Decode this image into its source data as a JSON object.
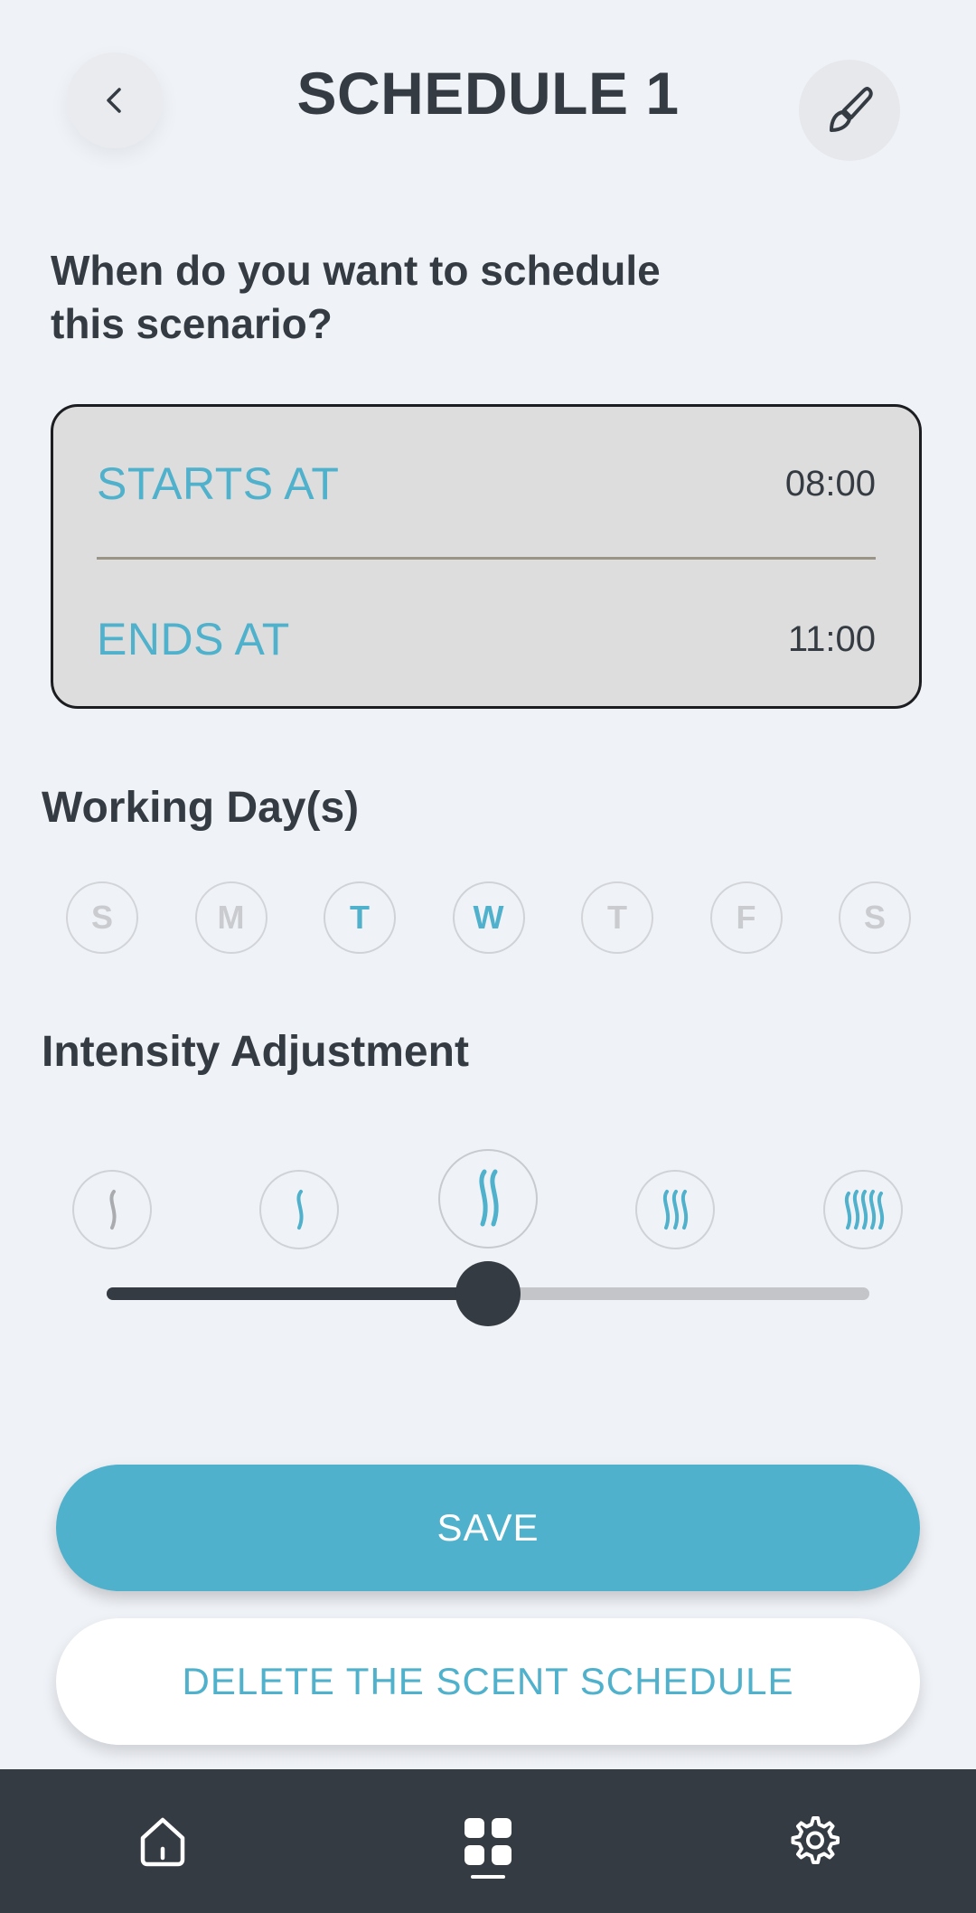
{
  "header": {
    "title": "SCHEDULE 1",
    "back_icon": "chevron-left-icon",
    "edit_icon": "paint-brush-icon"
  },
  "question": "When do you want to schedule this scenario?",
  "time": {
    "starts_label": "STARTS AT",
    "starts_value": "08:00",
    "ends_label": "ENDS AT",
    "ends_value": "11:00"
  },
  "working_days": {
    "heading": "Working Day(s)",
    "days": [
      {
        "label": "S",
        "active": false
      },
      {
        "label": "M",
        "active": false
      },
      {
        "label": "T",
        "active": true
      },
      {
        "label": "W",
        "active": true
      },
      {
        "label": "T",
        "active": false
      },
      {
        "label": "F",
        "active": false
      },
      {
        "label": "S",
        "active": false
      }
    ]
  },
  "intensity": {
    "heading": "Intensity Adjustment",
    "levels": 5,
    "selected_level": 3,
    "slider_fraction": 0.5
  },
  "buttons": {
    "save": "SAVE",
    "delete": "DELETE THE SCENT SCHEDULE"
  },
  "nav": {
    "items": [
      "home-icon",
      "grid-icon",
      "gear-icon"
    ],
    "active": "grid-icon"
  },
  "colors": {
    "accent": "#4fb1cb",
    "dark": "#353b42",
    "background": "#eff2f7"
  }
}
